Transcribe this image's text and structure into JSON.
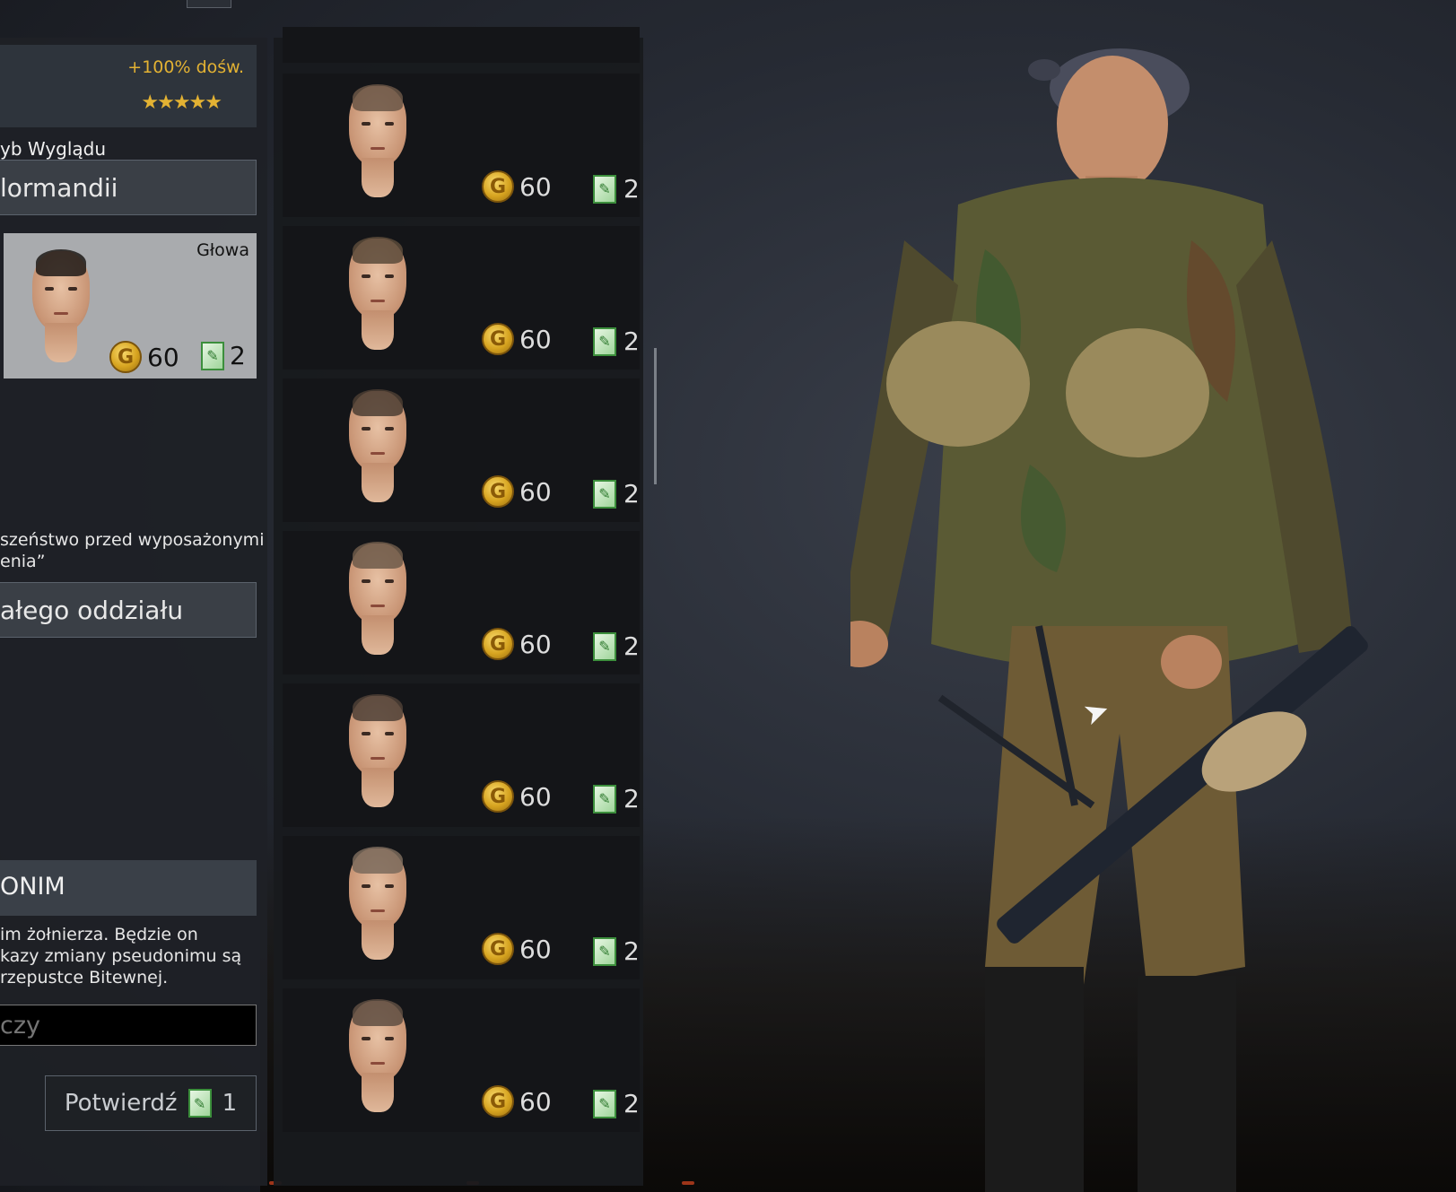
{
  "experience": {
    "bonus": "+100% dośw.",
    "stars": "★★★★★"
  },
  "appearance": {
    "section_label": "yb Wyglądu",
    "preset_value": "lormandii",
    "head_card": {
      "label": "Głowa",
      "gold": "60",
      "tickets": "2"
    }
  },
  "squad": {
    "desc_line1": "szeństwo przed wyposażonymi",
    "desc_line2": "enia”",
    "dropdown_value": "ałego oddziału"
  },
  "pseudonym": {
    "header": "ONIM",
    "desc_line1": "im żołnierza. Będzie on",
    "desc_line2": "kazy zmiany pseudonimu są",
    "desc_line3": "rzepustce Bitewnej.",
    "input_placeholder": "czy",
    "confirm_label": "Potwierdź",
    "confirm_cost": "1"
  },
  "faces": [
    {
      "gold": "60",
      "tickets": "2"
    },
    {
      "gold": "60",
      "tickets": "2"
    },
    {
      "gold": "60",
      "tickets": "2"
    },
    {
      "gold": "60",
      "tickets": "2"
    },
    {
      "gold": "60",
      "tickets": "2"
    },
    {
      "gold": "60",
      "tickets": "2"
    },
    {
      "gold": "60",
      "tickets": "2"
    }
  ],
  "icons": {
    "gold": "G",
    "ticket": "✎"
  },
  "colors": {
    "accent_gold": "#e3b233",
    "ticket_green": "#3c8f3c",
    "panel": "#1e2126"
  }
}
